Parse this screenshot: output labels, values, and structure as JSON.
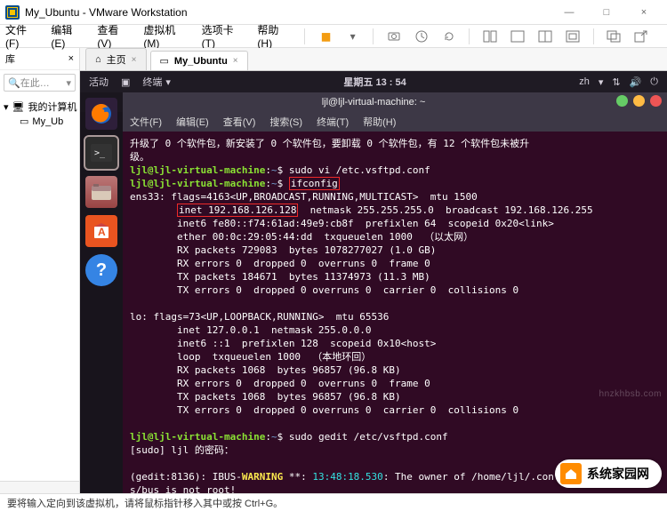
{
  "window": {
    "title": "My_Ubuntu - VMware Workstation",
    "min_tip": "—",
    "max_tip": "□",
    "close_tip": "×"
  },
  "menus": {
    "file": "文件(F)",
    "edit": "编辑(E)",
    "view": "查看(V)",
    "vm": "虚拟机(M)",
    "tab": "选项卡(T)",
    "help": "帮助(H)"
  },
  "left": {
    "header": "库",
    "close": "×",
    "search": "在此…",
    "tree": {
      "root": "我的计算机",
      "child": "My_Ub"
    }
  },
  "tabs": {
    "home": "主页",
    "active": "My_Ubuntu"
  },
  "vm": {
    "activities": "活动",
    "terminal_label": "终端",
    "clock": "星期五 13 : 54",
    "lang": "zh",
    "win_title": "ljl@ljl-virtual-machine: ~",
    "term_menu": {
      "file": "文件(F)",
      "edit": "编辑(E)",
      "view": "查看(V)",
      "search": "搜索(S)",
      "term": "终端(T)",
      "help": "帮助(H)"
    }
  },
  "dock": {
    "firefox": "firefox-icon",
    "terminal": "terminal-icon",
    "files": "files-icon",
    "software": "software-icon",
    "help": "help-icon"
  },
  "term": {
    "line1_a": "升级了 0 个软件包，新安装了 0 个软件包，要卸载 0 个软件包，有 12 个软件包未被升",
    "line1_b": "级。",
    "prompt_user": "ljl@ljl-virtual-machine",
    "prompt_path": "~",
    "cmd1": "sudo vi /etc.vsftpd.conf",
    "cmd2": "ifconfig",
    "if_ens_hdr": "ens33: flags=4163<UP,BROADCAST,RUNNING,MULTICAST>  mtu 1500",
    "if_inet": "inet 192.168.126.128",
    "if_inet_rest": "  netmask 255.255.255.0  broadcast 192.168.126.255",
    "if_inet6": "        inet6 fe80::f74:61ad:49e9:cb8f  prefixlen 64  scopeid 0x20<link>",
    "if_ether": "        ether 00:0c:29:05:44:dd  txqueuelen 1000  （以太网）",
    "if_rx1": "        RX packets 729083  bytes 1078277027 (1.0 GB)",
    "if_rx2": "        RX errors 0  dropped 0  overruns 0  frame 0",
    "if_tx1": "        TX packets 184671  bytes 11374973 (11.3 MB)",
    "if_tx2": "        TX errors 0  dropped 0 overruns 0  carrier 0  collisions 0",
    "lo_hdr": "lo: flags=73<UP,LOOPBACK,RUNNING>  mtu 65536",
    "lo_inet": "        inet 127.0.0.1  netmask 255.0.0.0",
    "lo_inet6": "        inet6 ::1  prefixlen 128  scopeid 0x10<host>",
    "lo_loop": "        loop  txqueuelen 1000  （本地环回）",
    "lo_rx1": "        RX packets 1068  bytes 96857 (96.8 KB)",
    "lo_rx2": "        RX errors 0  dropped 0  overruns 0  frame 0",
    "lo_tx1": "        TX packets 1068  bytes 96857 (96.8 KB)",
    "lo_tx2": "        TX errors 0  dropped 0 overruns 0  carrier 0  collisions 0",
    "cmd3": "sudo gedit /etc/vsftpd.conf",
    "sudo_pw": "[sudo] ljl 的密码：",
    "gedit_pfx": "(gedit:8136): IBUS-",
    "gedit_warn": "WARNING",
    "gedit_rest1": " **: ",
    "gedit_time": "13:48:18.530",
    "gedit_rest2": ": The owner of /home/ljl/.config/ibu",
    "gedit_l2": "s/bus is not root!"
  },
  "status": "要将输入定向到该虚拟机，请将鼠标指针移入其中或按 Ctrl+G。",
  "watermark": "系统家园网",
  "watermark_url": "hnzkhbsb.com"
}
